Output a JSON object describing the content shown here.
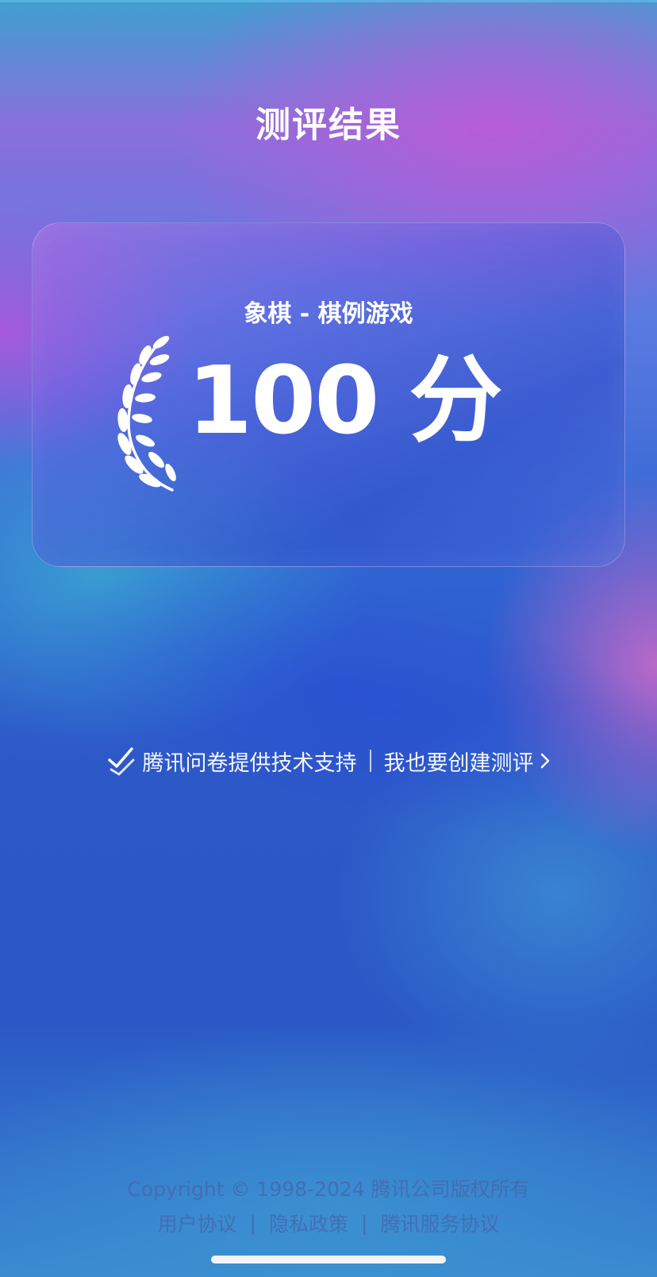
{
  "page": {
    "title": "测评结果"
  },
  "result_card": {
    "subtitle": "象棋 - 棋例游戏",
    "score": "100 分",
    "icon": "laurel-icon"
  },
  "powered_by": {
    "text": "腾讯问卷提供技术支持",
    "separator": "|",
    "create_link": "我也要创建测评",
    "icons": [
      "check-icon",
      "chevron-right-icon"
    ]
  },
  "footer": {
    "copyright": "Copyright © 1998-2024 腾讯公司版权所有",
    "links": [
      "用户协议",
      "隐私政策",
      "腾讯服务协议"
    ],
    "separator": "|"
  },
  "colors": {
    "text": "#ffffff",
    "footer_text": "#4669af",
    "background_primary": "#2a55c9",
    "background_accent": "#b45ad7"
  }
}
